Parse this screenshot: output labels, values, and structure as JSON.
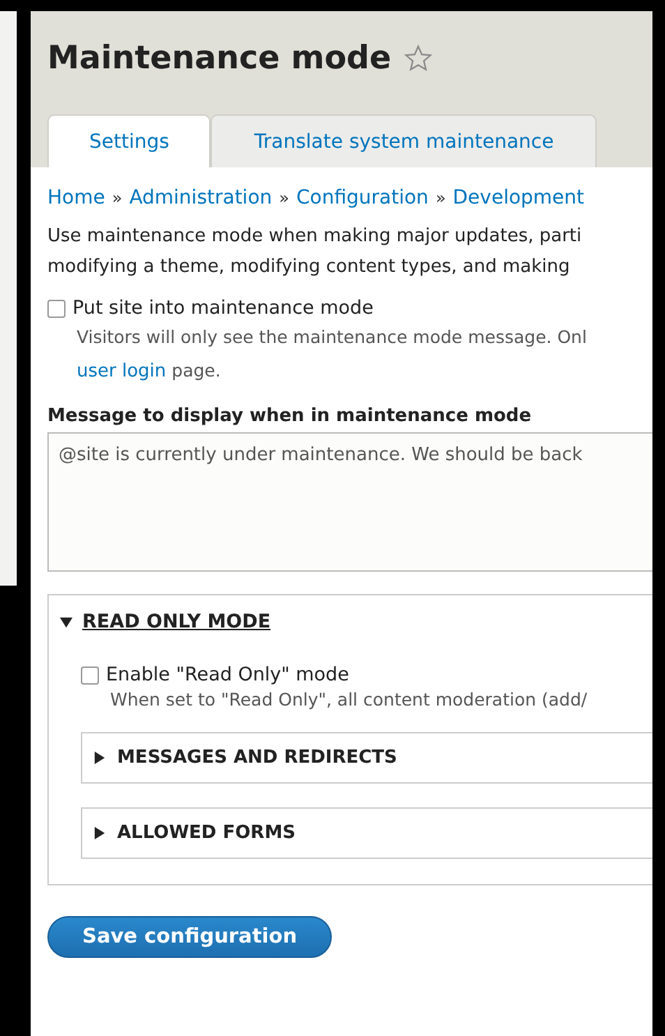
{
  "page": {
    "title": "Maintenance mode",
    "starred": false
  },
  "tabs": [
    {
      "label": "Settings",
      "selected": true
    },
    {
      "label": "Translate system maintenance",
      "selected": false
    }
  ],
  "breadcrumb": [
    {
      "label": "Home"
    },
    {
      "separator": "»",
      "label": "Administration"
    },
    {
      "separator": "»",
      "label": "Configuration"
    },
    {
      "separator": "»",
      "label": "Development"
    }
  ],
  "intro": [
    "Use maintenance mode when making major updates, parti",
    "modifying a theme, modifying content types, and making"
  ],
  "maintenance_checkbox": {
    "label": "Put site into maintenance mode",
    "checked": false,
    "description": "Visitors will only see the maintenance mode message. Onl",
    "link": "user login",
    "description_end": "page."
  },
  "message": {
    "label": "Message to display when in maintenance mode",
    "value": "@site is currently under maintenance. We should be back"
  },
  "read_only": {
    "title": "READ ONLY MODE",
    "expanded": true,
    "checkbox": {
      "label": "Enable \"Read Only\" mode",
      "checked": false,
      "description": "When set to \"Read Only\", all content moderation (add/"
    },
    "sections": [
      {
        "title": "MESSAGES AND REDIRECTS",
        "expanded": false
      },
      {
        "title": "ALLOWED FORMS",
        "expanded": false
      }
    ]
  },
  "save_button": "Save configuration"
}
